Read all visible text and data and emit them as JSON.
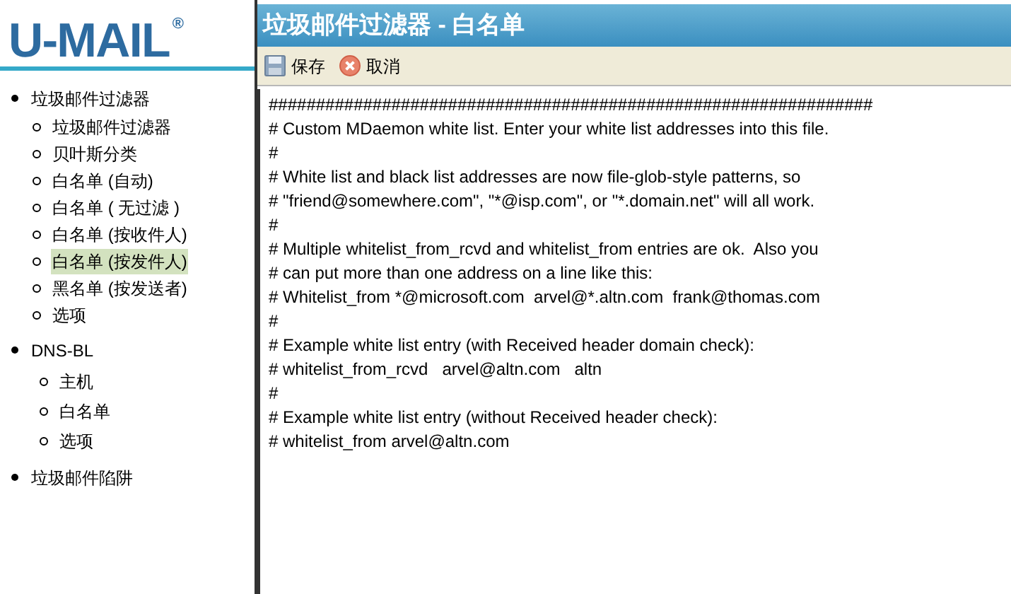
{
  "logo": {
    "text": "U-MAIL",
    "mark": "®"
  },
  "sidebar": {
    "items": [
      {
        "label": "垃圾邮件过滤器",
        "selected": false,
        "children": [
          {
            "label": "垃圾邮件过滤器",
            "selected": false
          },
          {
            "label": "贝叶斯分类",
            "selected": false
          },
          {
            "label": "白名单 (自动)",
            "selected": false
          },
          {
            "label": "白名单 ( 无过滤 )",
            "selected": false
          },
          {
            "label": "白名单 (按收件人)",
            "selected": false
          },
          {
            "label": "白名单 (按发件人)",
            "selected": true
          },
          {
            "label": "黑名单 (按发送者)",
            "selected": false
          },
          {
            "label": "选项",
            "selected": false
          }
        ]
      },
      {
        "label": "DNS-BL",
        "selected": false,
        "children": [
          {
            "label": "主机",
            "selected": false
          },
          {
            "label": "白名单",
            "selected": false
          },
          {
            "label": "选项",
            "selected": false
          }
        ]
      },
      {
        "label": "垃圾邮件陷阱",
        "selected": false
      }
    ]
  },
  "header": {
    "title": "垃圾邮件过滤器 - 白名单"
  },
  "toolbar": [
    {
      "kind": "save",
      "label": "保存"
    },
    {
      "kind": "cancel",
      "label": "取消"
    }
  ],
  "editor": {
    "lines": [
      "################################################################",
      "# Custom MDaemon white list. Enter your white list addresses into this file.",
      "#",
      "# White list and black list addresses are now file-glob-style patterns, so",
      "# \"friend@somewhere.com\", \"*@isp.com\", or \"*.domain.net\" will all work.",
      "#",
      "# Multiple whitelist_from_rcvd and whitelist_from entries are ok.  Also you",
      "# can put more than one address on a line like this:",
      "# Whitelist_from *@microsoft.com  arvel@*.altn.com  frank@thomas.com",
      "#",
      "# Example white list entry (with Received header domain check):",
      "# whitelist_from_rcvd   arvel@altn.com   altn",
      "#",
      "# Example white list entry (without Received header check):",
      "# whitelist_from arvel@altn.com"
    ]
  }
}
